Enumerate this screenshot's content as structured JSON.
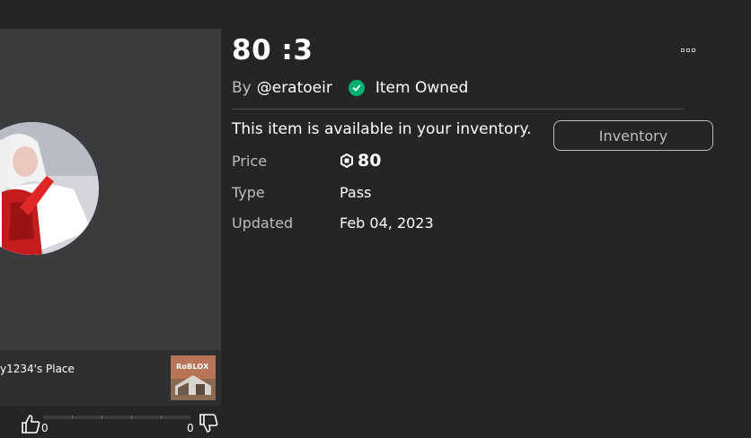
{
  "item": {
    "title": "80 :3",
    "by_label": "By",
    "creator": "@eratoeir",
    "owned_text": "Item Owned",
    "available_text": "This item is available in your inventory.",
    "inventory_button": "Inventory"
  },
  "details": {
    "price_label": "Price",
    "price_value": "80",
    "type_label": "Type",
    "type_value": "Pass",
    "updated_label": "Updated",
    "updated_value": "Feb 04, 2023"
  },
  "place": {
    "name": "y1234's Place",
    "thumbnail_logo": "RoBLOX"
  },
  "votes": {
    "up": "0",
    "down": "0"
  },
  "icons": {
    "more": "more-options-icon",
    "owned": "check-circle-icon",
    "currency": "robux-icon",
    "vote_up": "thumbs-up-icon",
    "vote_down": "thumbs-down-icon"
  },
  "colors": {
    "background": "#232527",
    "panel": "#393b3d",
    "owned_green": "#00b06f",
    "muted_text": "#bdbebe"
  }
}
